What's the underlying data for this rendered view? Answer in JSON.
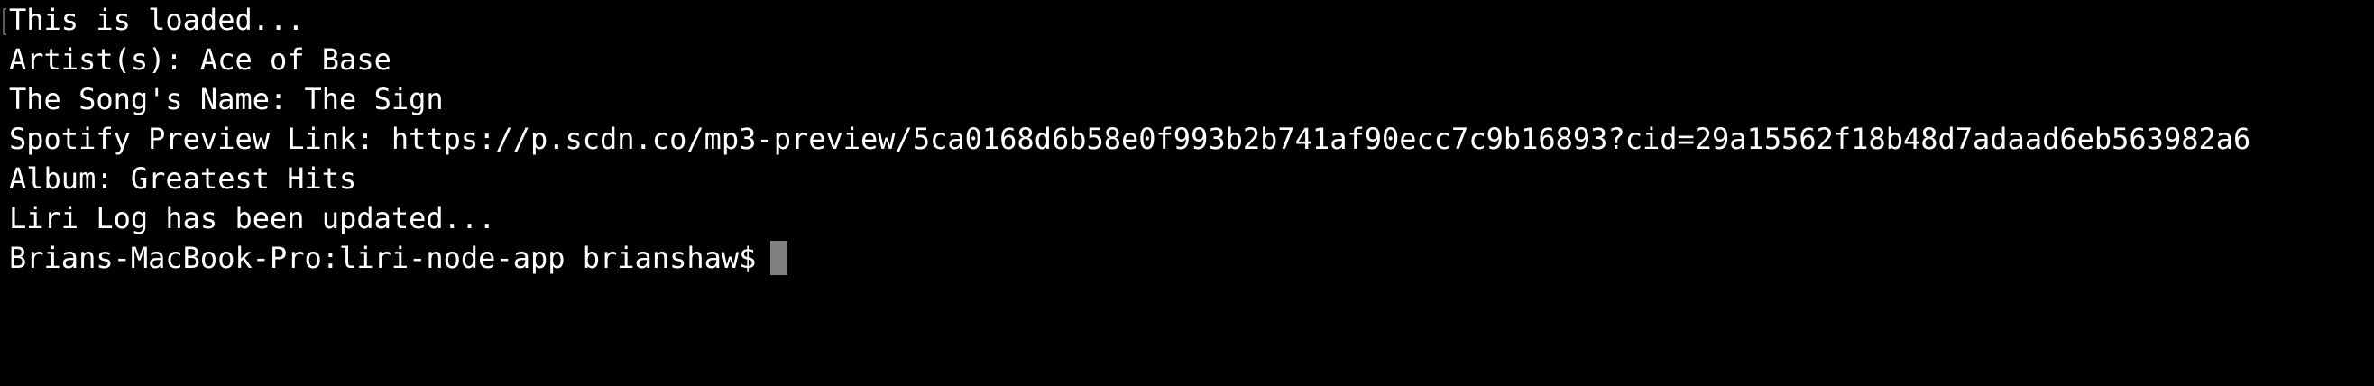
{
  "terminal": {
    "lines": [
      "This is loaded...",
      "Artist(s): Ace of Base",
      "The Song's Name: The Sign",
      "Spotify Preview Link: https://p.scdn.co/mp3-preview/5ca0168d6b58e0f993b2b741af90ecc7c9b16893?cid=29a15562f18b48d7adaad6eb563982a6",
      "Album: Greatest Hits",
      "Liri Log has been updated..."
    ],
    "prompt": "Brians-MacBook-Pro:liri-node-app brianshaw$",
    "background_color": "#000000",
    "text_color": "#ffffff",
    "cursor_color": "#7f7f7f"
  }
}
